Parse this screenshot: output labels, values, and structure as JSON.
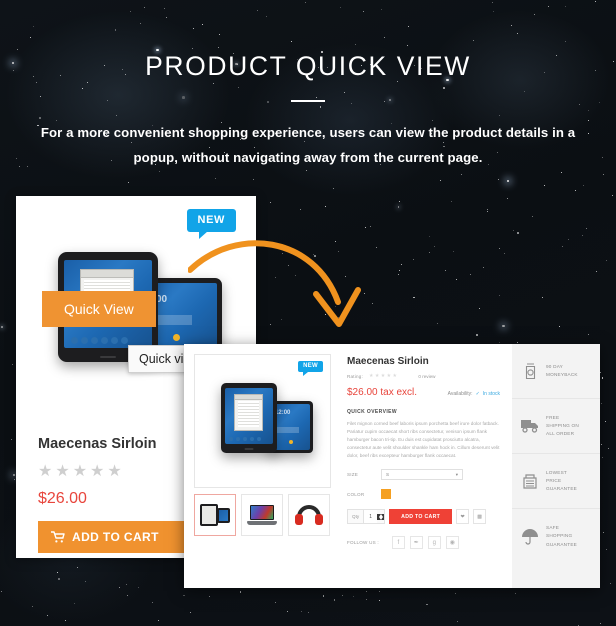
{
  "header": {
    "title": "PRODUCT QUICK VIEW",
    "subtitle": "For a more convenient shopping experience, users can view the product details in a popup, without navigating away from the current page."
  },
  "colors": {
    "background": "#0c1014",
    "badge_blue": "#11a4e8",
    "cart_orange": "#f0922f",
    "quickview_orange": "#ef9332",
    "price_red": "#e8453c",
    "modal_cart_red": "#ef4136",
    "arrow_orange": "#f0921e",
    "swatch_orange": "#f5a021"
  },
  "product_card": {
    "badge": "NEW",
    "quick_view_button": "Quick View",
    "quick_view_tooltip": "Quick view",
    "name": "Maecenas Sirloin",
    "stars": "★★★★★",
    "price": "$26.00",
    "add_to_cart": "ADD TO CART",
    "cart_icon": "cart-icon",
    "wishlist_icon": "heart-icon"
  },
  "modal": {
    "badge": "NEW",
    "thumbnails": [
      {
        "name": "tablets",
        "selected": true
      },
      {
        "name": "laptop",
        "selected": false
      },
      {
        "name": "headphones",
        "selected": false
      }
    ],
    "title": "Maecenas Sirloin",
    "rating_label": "Rating:",
    "stars": "★★★★★",
    "reviews": "0 review",
    "price": "$26.00 tax excl.",
    "availability_label": "Availability:",
    "availability_value": "In stock",
    "overview_title": "QUICK OVERVIEW",
    "overview_text": "Filet mignon corned beef laboris ipsum porchetta beef irure dolor fatback. Pariatur cupim occaecat short ribs consectetur, venison ipsum flank hamburger bacon tri-tip. Eu duis est cupidatat prosciutto alcatra, consectetur aute velit shoulder shankle ham hock in. Cillum deserunt velit dolor, beef ribs excepteur hamburger flank occaecat.",
    "size_label": "SIZE",
    "size_value": "S",
    "color_label": "COLOR",
    "qty_label": "Qty",
    "qty_value": "1",
    "add_to_cart": "ADD TO CART",
    "wishlist_icon": "heart-icon",
    "compare_icon": "compare-icon",
    "follow_label": "FOLLOW US :",
    "social": [
      {
        "name": "facebook-icon",
        "glyph": "f"
      },
      {
        "name": "twitter-icon",
        "glyph": "✒"
      },
      {
        "name": "google-plus-icon",
        "glyph": "g"
      },
      {
        "name": "pinterest-icon",
        "glyph": "◉"
      }
    ],
    "features": [
      {
        "icon": "moneyback-icon",
        "line1": "90 DAY",
        "line2": "MONEYBACK",
        "line3": ""
      },
      {
        "icon": "truck-icon",
        "line1": "FREE",
        "line2": "SHIPPING ON",
        "line3": "ALL ORDER"
      },
      {
        "icon": "price-tag-icon",
        "line1": "LOWEST",
        "line2": "PRICE",
        "line3": "GUARANTEE"
      },
      {
        "icon": "umbrella-icon",
        "line1": "SAFE",
        "line2": "SHOPPING",
        "line3": "GUARANTEE"
      }
    ]
  }
}
